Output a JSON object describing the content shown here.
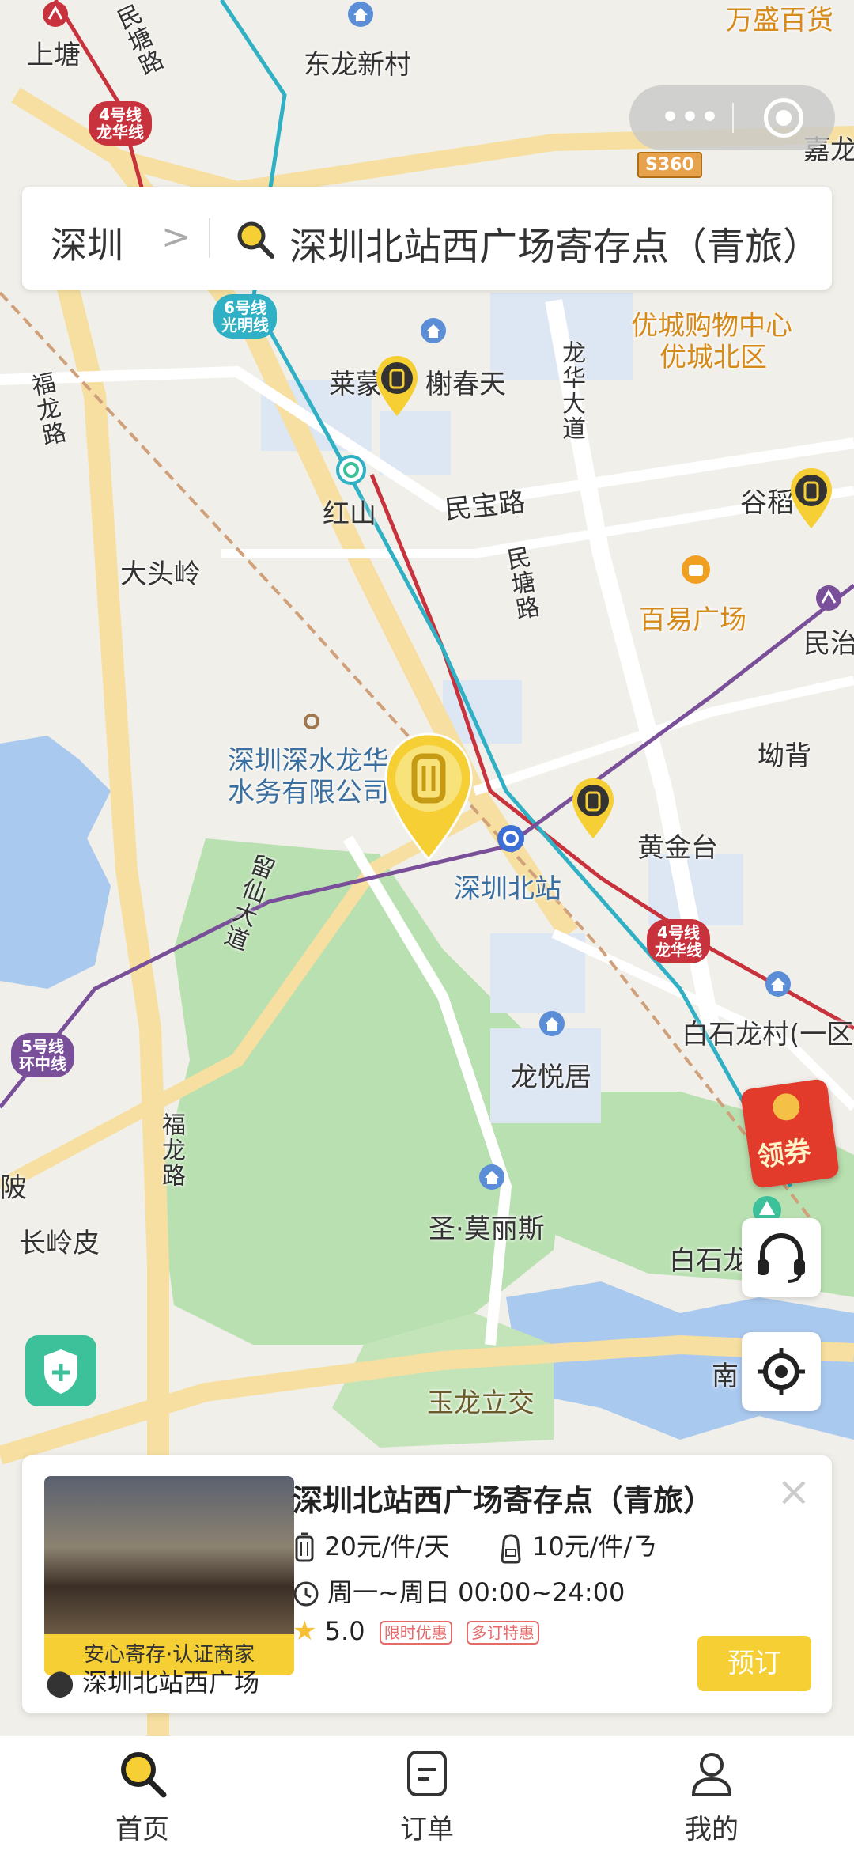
{
  "map": {
    "labels": {
      "shangtang": "上塘",
      "donglong": "东龙新村",
      "wansheng": "万盛百货",
      "jialong": "嘉龙",
      "mintang_road_top": "民塘路",
      "fulong_road": "福龙路",
      "laimeng": "莱蒙",
      "shuchuntian": "榭春天",
      "youcheng_mall": "优城购物中心",
      "youcheng_north": "优城北区",
      "longhua_ave": "龙华大道",
      "hongshan": "红山",
      "minbao_road": "民宝路",
      "guhe": "谷稻",
      "datouling": "大头岭",
      "mintang_road": "民塘路",
      "baiyi_plaza": "百易广场",
      "minzhi": "民治",
      "water_company": "深圳深水龙华\n水务有限公司",
      "aobei": "坳背",
      "huangjintai": "黄金台",
      "shenzhen_north": "深圳北站",
      "liuxian_ave": "留仙大道",
      "baishilong": "白石龙村(一区)",
      "longyueju": "龙悦居",
      "fulong_road_2": "福龙路",
      "po": "陂",
      "changlingpi": "长岭皮",
      "shenglisi": "圣·莫丽斯",
      "baishilong_park": "白石龙公园",
      "nan": "南",
      "yulong_interchange": "玉龙立交"
    },
    "metro": {
      "line4_top": "4号线\n龙华线",
      "line6": "6号线\n光明线",
      "line4_mid": "4号线\n龙华线",
      "line5": "5号线\n环中线"
    },
    "road_sign": "S360"
  },
  "search": {
    "city": "深圳",
    "chevron": ">",
    "query": "深圳北站西广场寄存点（青旅）"
  },
  "coupon": {
    "label": "领券"
  },
  "card": {
    "title": "深圳北站西广场寄存点（青旅）",
    "luggage_price": "20元/件/天",
    "bag_price": "10元/件/ㄋ",
    "hours": "周一~周日 00:00~24:00",
    "rating": "5.0",
    "tag1": "限时优惠",
    "tag2": "多订特惠",
    "badge": "安心寄存·认证商家",
    "address": "深圳北站西广场",
    "book_label": "预订",
    "close": "×"
  },
  "tabs": [
    {
      "label": "首页",
      "icon": "search-icon",
      "active": true
    },
    {
      "label": "订单",
      "icon": "order-icon",
      "active": false
    },
    {
      "label": "我的",
      "icon": "profile-icon",
      "active": false
    }
  ],
  "colors": {
    "accent": "#f5cf33",
    "line4": "#c8323c",
    "line6": "#2fb0c4",
    "line5": "#7a4f9a"
  }
}
